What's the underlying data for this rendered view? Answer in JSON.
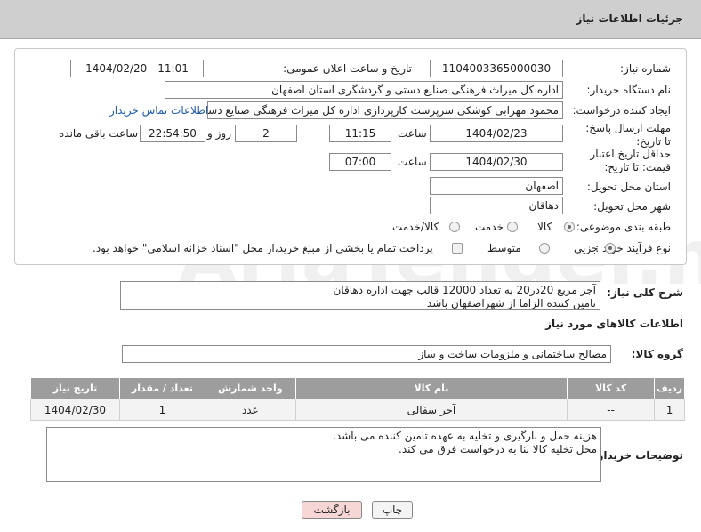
{
  "header": {
    "title": "جزئیات اطلاعات نیاز"
  },
  "form": {
    "need_number_label": "شماره نیاز:",
    "need_number": "1104003365000030",
    "announce_label": "تاریخ و ساعت اعلان عمومی:",
    "announce_value": "1404/02/20 - 11:01",
    "buyer_org_label": "نام دستگاه خریدار:",
    "buyer_org": "اداره کل میراث فرهنگی  صنایع دستی و گردشگری استان اصفهان",
    "requester_label": "ایجاد کننده درخواست:",
    "requester": "محمود مهرابی کوشکی سرپرست کارپردازی اداره کل میراث فرهنگی  صنایع دستی",
    "contact_link": "اطلاعات تماس خریدار",
    "reply_deadline_label": "مهلت ارسال پاسخ: تا تاریخ:",
    "reply_date": "1404/02/23",
    "time_label": "ساعت",
    "reply_time": "11:15",
    "days_value": "2",
    "days_label": "روز و",
    "remaining_time": "22:54:50",
    "remaining_label": "ساعت باقی مانده",
    "validity_label": "حداقل تاریخ اعتبار قیمت: تا تاریخ:",
    "validity_date": "1404/02/30",
    "validity_time": "07:00",
    "province_label": "استان محل تحویل:",
    "province": "اصفهان",
    "city_label": "شهر محل تحویل:",
    "city": "دهاقان",
    "category_label": "طبقه بندی موضوعی:",
    "category_options": [
      "کالا",
      "خدمت",
      "کالا/خدمت"
    ],
    "process_label": "نوع فرآیند خرید :",
    "process_options": [
      "جزیی",
      "متوسط"
    ],
    "payment_note": "پرداخت تمام یا بخشی از مبلغ خرید،از محل \"اسناد خزانه اسلامی\" خواهد بود."
  },
  "description": {
    "label": "شرح کلی نیاز:",
    "line1": "آجر مربع 20در20 به تعداد 12000 قالب جهت اداره دهاقان",
    "line2": "تامین کننده الزاما از شهراصفهان باشد"
  },
  "goods": {
    "section_title": "اطلاعات کالاهای مورد نیاز",
    "group_label": "گروه کالا:",
    "group_value": "مصالح ساختمانی و ملزومات ساخت و ساز",
    "columns": [
      "ردیف",
      "کد کالا",
      "نام کالا",
      "واحد شمارش",
      "تعداد / مقدار",
      "تاریخ نیاز"
    ],
    "rows": [
      {
        "row": "1",
        "code": "--",
        "name": "آجر سفالی",
        "unit": "عدد",
        "qty": "1",
        "date": "1404/02/30"
      }
    ]
  },
  "buyer_notes": {
    "label": "توضیحات خریدار:",
    "line1": "هزینه حمل و بارگیری و تخلیه به عهده تامین کننده می باشد.",
    "line2": "محل تخلیه کالا بنا به درخواست فرق می کند."
  },
  "buttons": {
    "print": "چاپ",
    "back": "بازگشت"
  },
  "colors": {
    "header_bg": "#cfcfcf",
    "table_head": "#9d9d9d",
    "link": "#1f5ba8",
    "back_btn": "#f7d6d6"
  },
  "watermark": "AriaTender.neT"
}
